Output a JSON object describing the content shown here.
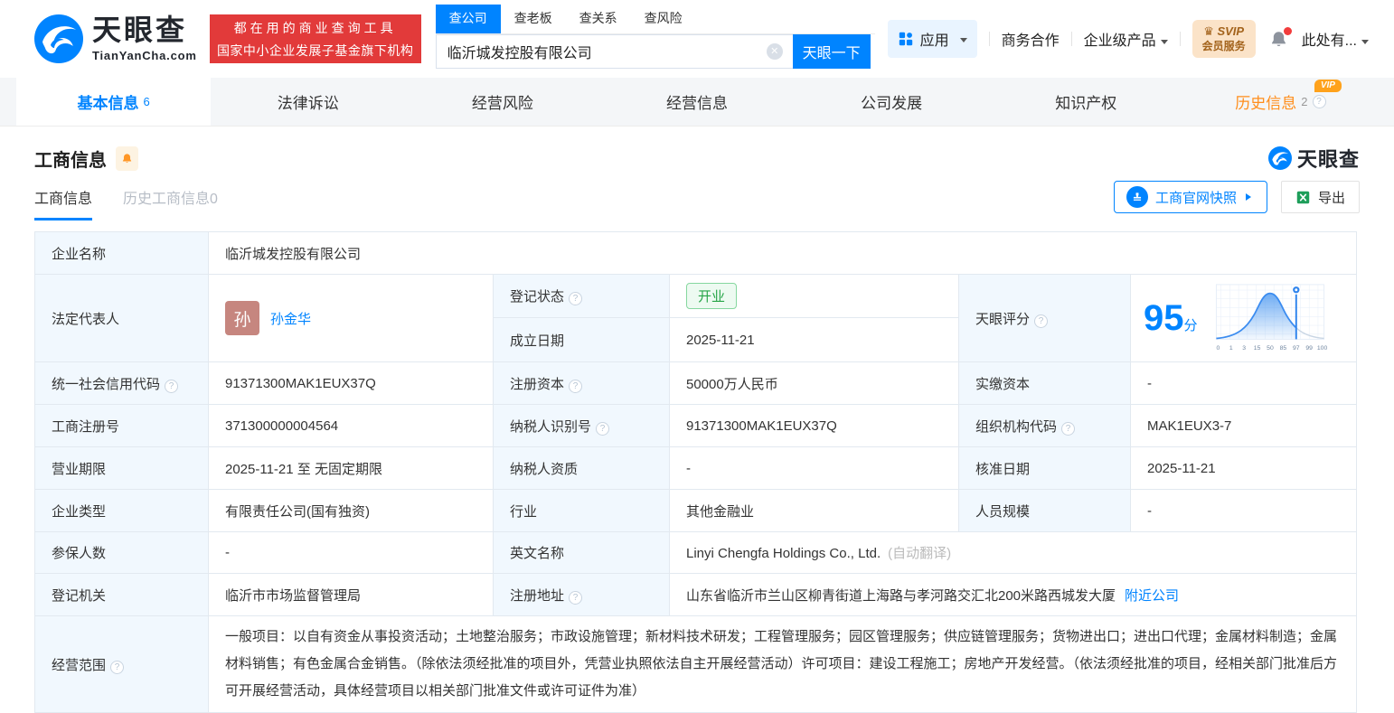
{
  "header": {
    "logo": {
      "title": "天眼查",
      "domain": "TianYanCha.com"
    },
    "slogan": {
      "line1": "都在用的商业查询工具",
      "line2": "国家中小企业发展子基金旗下机构"
    },
    "search": {
      "tabs": [
        {
          "label": "查公司",
          "active": true
        },
        {
          "label": "查老板",
          "active": false
        },
        {
          "label": "查关系",
          "active": false
        },
        {
          "label": "查风险",
          "active": false
        }
      ],
      "value": "临沂城发控股有限公司",
      "button": "天眼一下"
    },
    "nav": {
      "apps": "应用",
      "cooperation": "商务合作",
      "enterprise": "企业级产品",
      "svip_line1": "SVIP",
      "svip_line2": "会员服务",
      "user": "此处有..."
    }
  },
  "tabs": [
    {
      "label": "基本信息",
      "count": "6"
    },
    {
      "label": "法律诉讼"
    },
    {
      "label": "经营风险"
    },
    {
      "label": "经营信息"
    },
    {
      "label": "公司发展"
    },
    {
      "label": "知识产权"
    },
    {
      "label": "历史信息",
      "count": "2",
      "vip": "VIP"
    }
  ],
  "section": {
    "title": "工商信息",
    "watermark": "天眼查",
    "subtabs": [
      {
        "label": "工商信息",
        "active": true
      },
      {
        "label": "历史工商信息0",
        "active": false
      }
    ],
    "snapshot_button": "工商官网快照",
    "export_button": "导出"
  },
  "table": {
    "company_name": {
      "label": "企业名称",
      "value": "临沂城发控股有限公司"
    },
    "legal_rep": {
      "label": "法定代表人",
      "avatar": "孙",
      "name": "孙金华"
    },
    "reg_status": {
      "label": "登记状态",
      "value": "开业"
    },
    "establish_date": {
      "label": "成立日期",
      "value": "2025-11-21"
    },
    "score": {
      "label": "天眼评分",
      "value": "95",
      "unit": "分",
      "axis": [
        "0",
        "1",
        "3",
        "15",
        "50",
        "85",
        "97",
        "99",
        "100"
      ]
    },
    "credit_code": {
      "label": "统一社会信用代码",
      "value": "91371300MAK1EUX37Q"
    },
    "reg_capital": {
      "label": "注册资本",
      "value": "50000万人民币"
    },
    "paid_capital": {
      "label": "实缴资本",
      "value": "-"
    },
    "reg_number": {
      "label": "工商注册号",
      "value": "371300000004564"
    },
    "taxpayer_id": {
      "label": "纳税人识别号",
      "value": "91371300MAK1EUX37Q"
    },
    "org_code": {
      "label": "组织机构代码",
      "value": "MAK1EUX3-7"
    },
    "business_term": {
      "label": "营业期限",
      "value": "2025-11-21 至 无固定期限"
    },
    "taxpayer_quality": {
      "label": "纳税人资质",
      "value": "-"
    },
    "approval_date": {
      "label": "核准日期",
      "value": "2025-11-21"
    },
    "company_type": {
      "label": "企业类型",
      "value": "有限责任公司(国有独资)"
    },
    "industry": {
      "label": "行业",
      "value": "其他金融业"
    },
    "staff_size": {
      "label": "人员规模",
      "value": "-"
    },
    "insured_count": {
      "label": "参保人数",
      "value": "-"
    },
    "english_name": {
      "label": "英文名称",
      "value": "Linyi Chengfa Holdings Co., Ltd.",
      "note": "(自动翻译)"
    },
    "reg_authority": {
      "label": "登记机关",
      "value": "临沂市市场监督管理局"
    },
    "address": {
      "label": "注册地址",
      "value": "山东省临沂市兰山区柳青街道上海路与孝河路交汇北200米路西城发大厦",
      "link": "附近公司"
    },
    "business_scope": {
      "label": "经营范围",
      "value": "一般项目：以自有资金从事投资活动；土地整治服务；市政设施管理；新材料技术研发；工程管理服务；园区管理服务；供应链管理服务；货物进出口；进出口代理；金属材料制造；金属材料销售；有色金属合金销售。（除依法须经批准的项目外，凭营业执照依法自主开展经营活动）许可项目：建设工程施工；房地产开发经营。（依法须经批准的项目，经相关部门批准后方可开展经营活动，具体经营项目以相关部门批准文件或许可证件为准）"
    }
  },
  "colors": {
    "accent_blue": "#0084ff",
    "banner_red": "#e23a3a",
    "history_orange": "#ff8e1c",
    "status_green": "#27a548",
    "avatar_bg": "#c6867f"
  }
}
